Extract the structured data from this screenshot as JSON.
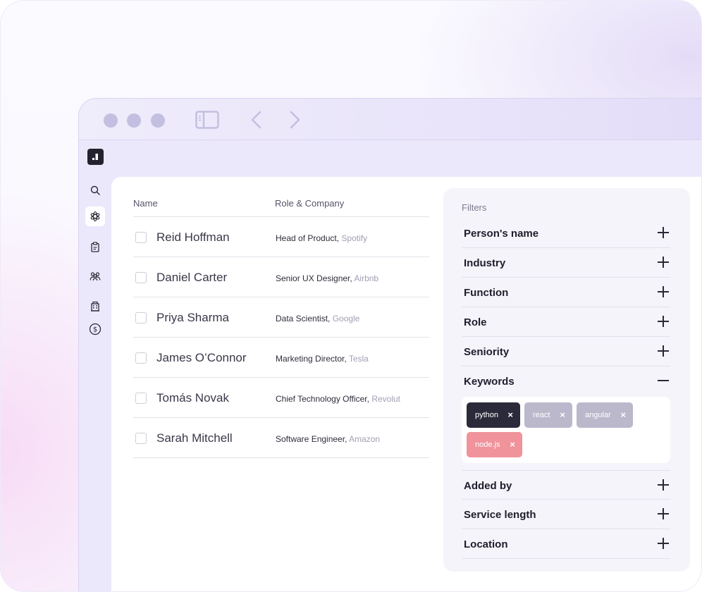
{
  "table": {
    "headers": {
      "name": "Name",
      "role_company": "Role & Company"
    },
    "rows": [
      {
        "name": "Reid Hoffman",
        "role": "Head of Product",
        "company": "Spotify"
      },
      {
        "name": "Daniel Carter",
        "role": "Senior UX Designer",
        "company": "Airbnb"
      },
      {
        "name": "Priya Sharma",
        "role": "Data Scientist",
        "company": "Google"
      },
      {
        "name": "James O’Connor",
        "role": "Marketing Director",
        "company": "Tesla"
      },
      {
        "name": "Tomás Novak",
        "role": "Chief Technology Officer",
        "company": "Revolut"
      },
      {
        "name": "Sarah Mitchell",
        "role": "Software Engineer",
        "company": "Amazon"
      }
    ]
  },
  "filters": {
    "title": "Filters",
    "items": [
      {
        "label": "Person's name",
        "state": "collapsed"
      },
      {
        "label": "Industry",
        "state": "collapsed"
      },
      {
        "label": "Function",
        "state": "collapsed"
      },
      {
        "label": "Role",
        "state": "collapsed"
      },
      {
        "label": "Seniority",
        "state": "collapsed"
      },
      {
        "label": "Keywords",
        "state": "expanded"
      },
      {
        "label": "Added by",
        "state": "collapsed"
      },
      {
        "label": "Service length",
        "state": "collapsed"
      },
      {
        "label": "Location",
        "state": "collapsed"
      }
    ],
    "keywords": [
      {
        "label": "python",
        "color": "#2b2a3a"
      },
      {
        "label": "react",
        "color": "#bbb8cc"
      },
      {
        "label": "angular",
        "color": "#bbb8cc"
      },
      {
        "label": "node.js",
        "color": "#f0939b"
      }
    ],
    "remove_glyph": "×"
  },
  "sidebar": {
    "icons": [
      "search-icon",
      "ai-sparkle-icon",
      "clipboard-icon",
      "people-icon",
      "building-icon",
      "dollar-icon"
    ],
    "active": "ai-sparkle-icon"
  },
  "titlebar": {
    "icons": [
      "window-dot-icon",
      "window-dot-icon",
      "window-dot-icon",
      "sidebar-toggle-icon",
      "back-arrow-icon",
      "forward-arrow-icon"
    ]
  },
  "colors": {
    "accent_bg": "#ece8fb",
    "text_dark": "#1f1d2b",
    "muted": "#a19fb3"
  }
}
